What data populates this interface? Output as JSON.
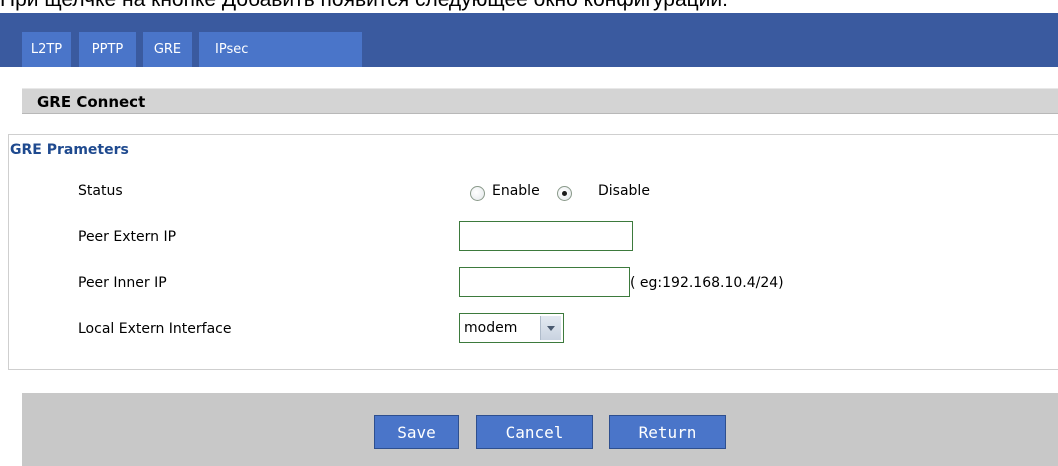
{
  "caption": "При щелчке на кнопке Добавить появится следующее окно конфигурации:",
  "tabs": [
    {
      "label": "L2TP"
    },
    {
      "label": "PPTP"
    },
    {
      "label": "GRE"
    },
    {
      "label": "IPsec"
    }
  ],
  "section_title": "GRE Connect",
  "params_title": "GRE Prameters",
  "fields": {
    "status_label": "Status",
    "enable_label": "Enable",
    "disable_label": "Disable",
    "status_selected": "Disable",
    "peer_extern_ip_label": "Peer Extern IP",
    "peer_extern_ip_value": "",
    "peer_inner_ip_label": "Peer Inner IP",
    "peer_inner_ip_value": "",
    "peer_inner_ip_hint": "( eg:192.168.10.4/24)",
    "local_extern_interface_label": "Local Extern Interface",
    "local_extern_interface_value": "modem"
  },
  "buttons": {
    "save": "Save",
    "cancel": "Cancel",
    "return": "Return"
  },
  "colors": {
    "tabbar": "#3a5a9f",
    "tab": "#4a75c9",
    "params_title": "#1f4a8f",
    "section_bar": "#d4d4d4",
    "action_bar": "#c8c8c8"
  }
}
